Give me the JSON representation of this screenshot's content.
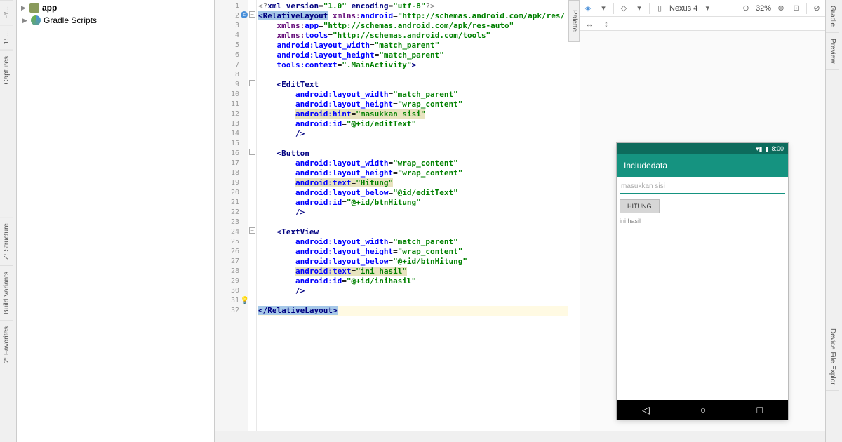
{
  "leftTabs": [
    "Pr...",
    "1: ...",
    "Captures",
    "Z: Structure",
    "Build Variants",
    "2: Favorites"
  ],
  "rightTabs": [
    "Gradle",
    "Preview",
    "Device File Explor"
  ],
  "project": {
    "app": "app",
    "gradle": "Gradle Scripts"
  },
  "paletteTab": "Palette",
  "designToolbar": {
    "device": "Nexus 4",
    "zoom": "32%"
  },
  "preview": {
    "time": "8:00",
    "appTitle": "Includedata",
    "hint": "masukkan sisi",
    "button": "HITUNG",
    "result": "ini hasil"
  },
  "code": {
    "lines": [
      {
        "n": 1,
        "html": "<span class='xml-gray'>&lt;?</span><span class='xml-tag'>xml version</span><span class='xml-gray'>=</span><span class='xml-val'>\"1.0\"</span> <span class='xml-tag'>encoding</span><span class='xml-gray'>=</span><span class='xml-val'>\"utf-8\"</span><span class='xml-gray'>?&gt;</span>"
      },
      {
        "n": 2,
        "html": "<span class='sel'><span class='xml-tag'>&lt;RelativeLayout</span></span> <span class='xml-ns'>xmlns:</span><span class='xml-attr'>android</span>=<span class='xml-val'>\"http://schemas.android.com/apk/res/</span>",
        "c": true
      },
      {
        "n": 3,
        "html": "    <span class='xml-ns'>xmlns:</span><span class='xml-attr'>app</span>=<span class='xml-val'>\"http://schemas.android.com/apk/res-auto\"</span>"
      },
      {
        "n": 4,
        "html": "    <span class='xml-ns'>xmlns:</span><span class='xml-attr'>tools</span>=<span class='xml-val'>\"http://schemas.android.com/tools\"</span>"
      },
      {
        "n": 5,
        "html": "    <span class='xml-attr'>android:layout_width</span>=<span class='xml-val'>\"match_parent\"</span>"
      },
      {
        "n": 6,
        "html": "    <span class='xml-attr'>android:layout_height</span>=<span class='xml-val'>\"match_parent\"</span>"
      },
      {
        "n": 7,
        "html": "    <span class='xml-attr'>tools:context</span>=<span class='xml-val'>\".MainActivity\"</span><span class='xml-tag'>&gt;</span>"
      },
      {
        "n": 8,
        "html": ""
      },
      {
        "n": 9,
        "html": "    <span class='xml-tag'>&lt;EditText</span>",
        "fold": true
      },
      {
        "n": 10,
        "html": "        <span class='xml-attr'>android:layout_width</span>=<span class='xml-val'>\"match_parent\"</span>"
      },
      {
        "n": 11,
        "html": "        <span class='xml-attr'>android:layout_height</span>=<span class='xml-val'>\"wrap_content\"</span>"
      },
      {
        "n": 12,
        "html": "        <span class='xml-hl'><span class='xml-attr'>android:hint</span>=<span class='xml-val'>\"masukkan sisi\"</span></span>"
      },
      {
        "n": 13,
        "html": "        <span class='xml-attr'>android:id</span>=<span class='xml-val'>\"@+id/editText\"</span>"
      },
      {
        "n": 14,
        "html": "        <span class='xml-tag'>/&gt;</span>"
      },
      {
        "n": 15,
        "html": ""
      },
      {
        "n": 16,
        "html": "    <span class='xml-tag'>&lt;Button</span>",
        "fold": true
      },
      {
        "n": 17,
        "html": "        <span class='xml-attr'>android:layout_width</span>=<span class='xml-val'>\"wrap_content\"</span>"
      },
      {
        "n": 18,
        "html": "        <span class='xml-attr'>android:layout_height</span>=<span class='xml-val'>\"wrap_content\"</span>"
      },
      {
        "n": 19,
        "html": "        <span class='xml-hl'><span class='xml-attr'>android:text</span>=<span class='xml-val'>\"Hitung\"</span></span>"
      },
      {
        "n": 20,
        "html": "        <span class='xml-attr'>android:layout_below</span>=<span class='xml-val'>\"@id/editText\"</span>"
      },
      {
        "n": 21,
        "html": "        <span class='xml-attr'>android:id</span>=<span class='xml-val'>\"@+id/btnHitung\"</span>"
      },
      {
        "n": 22,
        "html": "        <span class='xml-tag'>/&gt;</span>"
      },
      {
        "n": 23,
        "html": ""
      },
      {
        "n": 24,
        "html": "    <span class='xml-tag'>&lt;TextView</span>",
        "fold": true
      },
      {
        "n": 25,
        "html": "        <span class='xml-attr'>android:layout_width</span>=<span class='xml-val'>\"match_parent\"</span>"
      },
      {
        "n": 26,
        "html": "        <span class='xml-attr'>android:layout_height</span>=<span class='xml-val'>\"wrap_content\"</span>"
      },
      {
        "n": 27,
        "html": "        <span class='xml-attr'>android:layout_below</span>=<span class='xml-val'>\"@+id/btnHitung\"</span>"
      },
      {
        "n": 28,
        "html": "        <span class='xml-hl'><span class='xml-attr'>android:text</span>=<span class='xml-val'>\"ini hasil\"</span></span>"
      },
      {
        "n": 29,
        "html": "        <span class='xml-attr'>android:id</span>=<span class='xml-val'>\"@+id/inihasil\"</span>"
      },
      {
        "n": 30,
        "html": "        <span class='xml-tag'>/&gt;</span>"
      },
      {
        "n": 31,
        "html": "",
        "bulb": true
      },
      {
        "n": 32,
        "html": "<span class='sel'><span class='xml-tag'>&lt;/RelativeLayout&gt;</span></span>",
        "hl": true
      }
    ]
  }
}
